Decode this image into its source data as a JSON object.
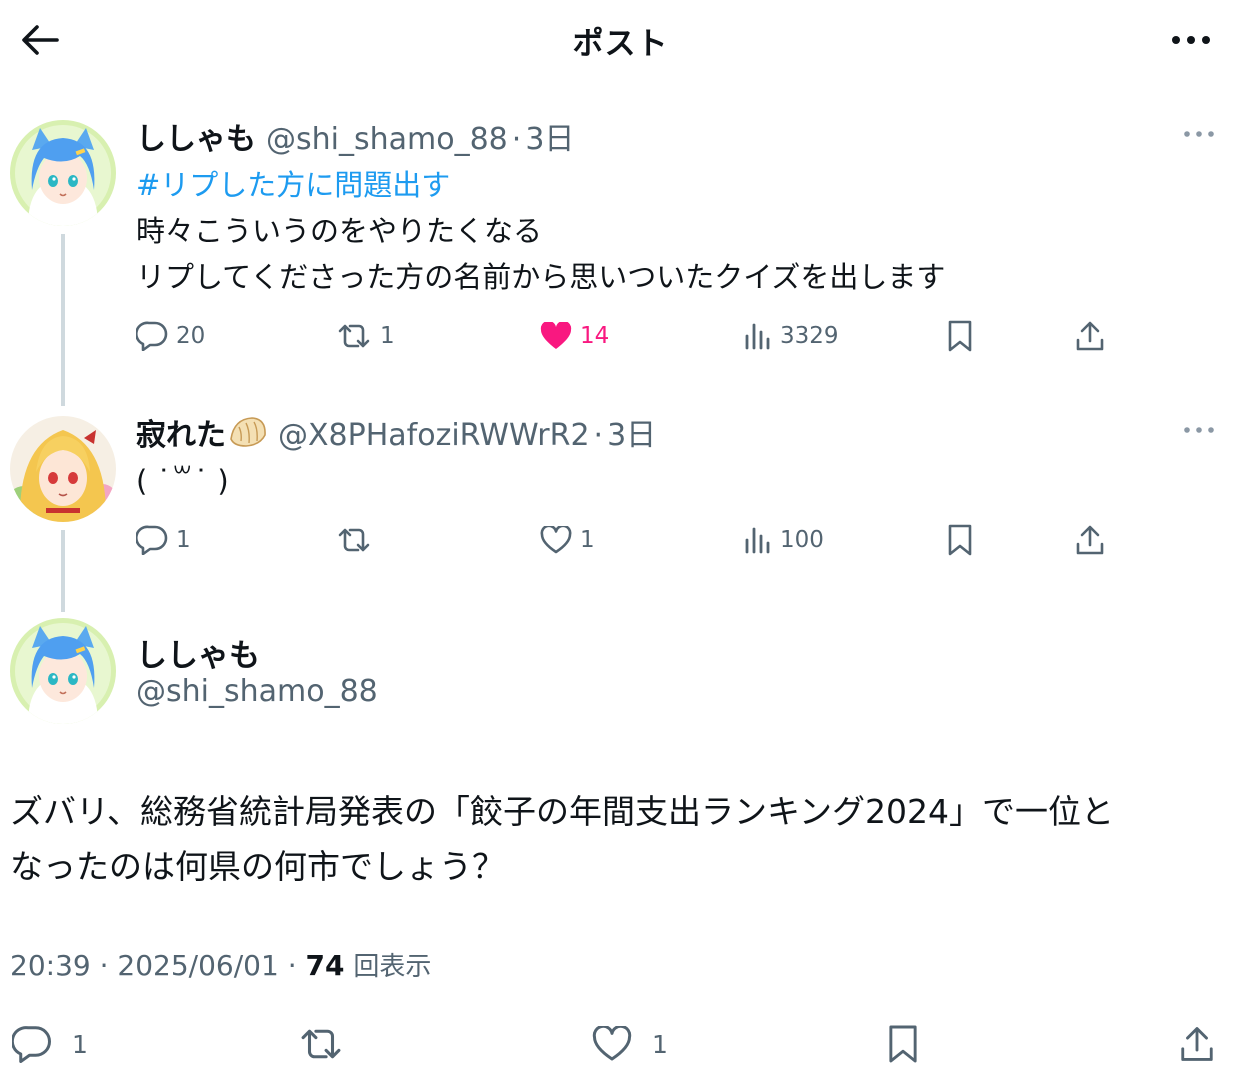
{
  "header": {
    "title": "ポスト"
  },
  "thread": [
    {
      "author": {
        "name": "ししゃも",
        "handle": "@shi_shamo_88",
        "time": "3日"
      },
      "hashtag": "#リプした方に問題出す",
      "lines": [
        "時々こういうのをやりたくなる",
        "リプしてくださった方の名前から思いついたクイズを出します"
      ],
      "stats": {
        "replies": "20",
        "reposts": "1",
        "likes": "14",
        "views": "3329"
      },
      "liked": true
    },
    {
      "author": {
        "name": "寂れた",
        "name_emoji": "dumpling-emoji",
        "handle": "@X8PHafoziRWWrR2",
        "time": "3日"
      },
      "lines": [
        "( ˙꒳˙ )"
      ],
      "stats": {
        "replies": "1",
        "reposts": "",
        "likes": "1",
        "views": "100"
      },
      "liked": false
    }
  ],
  "main_post": {
    "author": {
      "name": "ししゃも",
      "handle": "@shi_shamo_88"
    },
    "text_lines": [
      "ズバリ、総務省統計局発表の「餃子の年間支出ランキング2024」で一位と",
      "なったのは何県の何市でしょう？"
    ],
    "time": "20:39",
    "date": "2025/06/01",
    "views": "74",
    "views_label": "回表示",
    "stats": {
      "replies": "1",
      "reposts": "",
      "likes": "1"
    }
  },
  "colors": {
    "accent": "#1d9bf0",
    "like": "#f91880",
    "secondary_text": "#536471",
    "thread_line": "#cfd9de"
  },
  "icons": [
    "back-arrow-icon",
    "more-icon",
    "reply-icon",
    "repost-icon",
    "heart-icon",
    "views-icon",
    "bookmark-icon",
    "share-icon"
  ]
}
